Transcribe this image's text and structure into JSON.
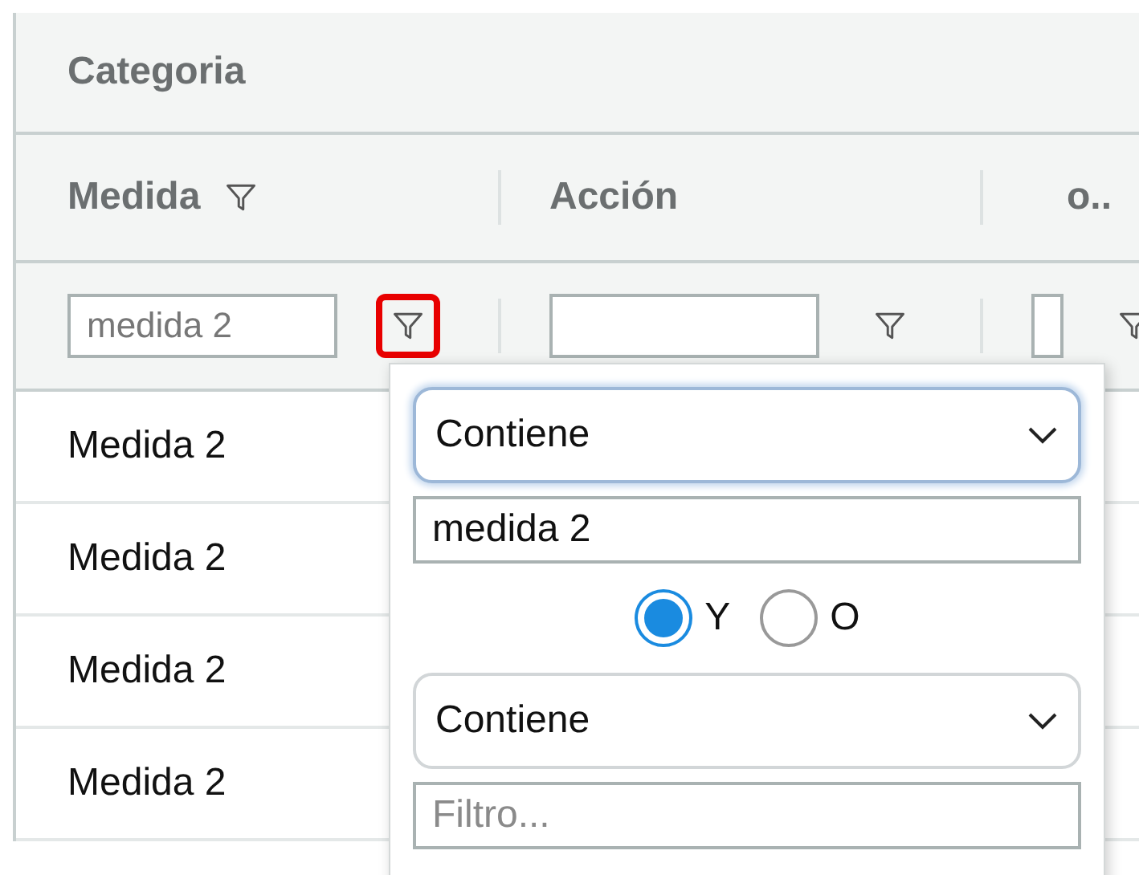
{
  "group_header": {
    "label": "Categoria"
  },
  "columns": [
    {
      "label": "Medida",
      "filter_icon": true
    },
    {
      "label": "Acción",
      "filter_icon": false
    },
    {
      "label": "o..",
      "filter_icon": false
    }
  ],
  "filter_row": [
    {
      "value": "medida 2",
      "highlighted": true
    },
    {
      "highlighted": false
    },
    {
      "highlighted": false
    }
  ],
  "rows": [
    {
      "cells": [
        "Medida 2"
      ]
    },
    {
      "cells": [
        "Medida 2"
      ]
    },
    {
      "cells": [
        "Medida 2"
      ]
    },
    {
      "cells": [
        "Medida 2"
      ]
    }
  ],
  "filter_popup": {
    "operator_1": {
      "value": "Contiene",
      "focused": true
    },
    "value_1": {
      "value": "medida 2"
    },
    "logic": [
      {
        "label": "Y",
        "selected": true
      },
      {
        "label": "O",
        "selected": false
      }
    ],
    "operator_2": {
      "value": "Contiene",
      "focused": false
    },
    "value_2": {
      "placeholder": "Filtro..."
    }
  }
}
